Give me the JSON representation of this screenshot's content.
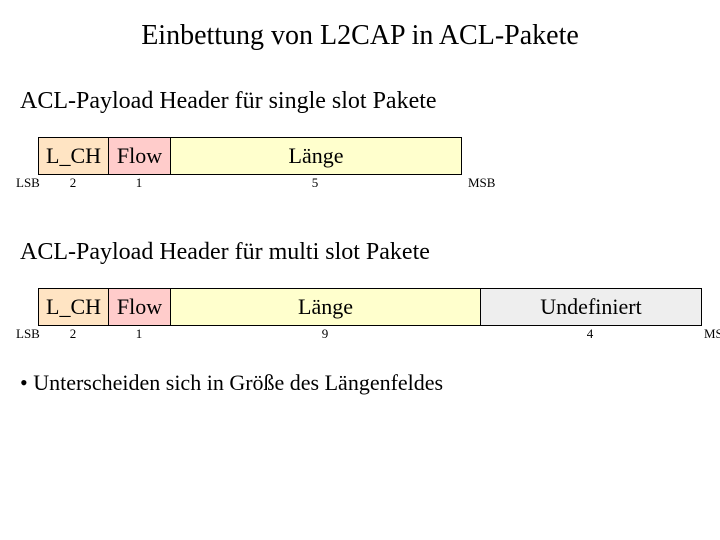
{
  "title": "Einbettung von L2CAP in ACL-Pakete",
  "sections": {
    "single": {
      "subtitle": "ACL-Payload Header für single slot Pakete",
      "lsb": "LSB",
      "msb": "MSB",
      "fields": {
        "lch": {
          "label": "L_CH",
          "bits": "2"
        },
        "flow": {
          "label": "Flow",
          "bits": "1"
        },
        "len": {
          "label": "Länge",
          "bits": "5"
        }
      }
    },
    "multi": {
      "subtitle": "ACL-Payload Header für multi slot Pakete",
      "lsb": "LSB",
      "msb": "MSB",
      "fields": {
        "lch": {
          "label": "L_CH",
          "bits": "2"
        },
        "flow": {
          "label": "Flow",
          "bits": "1"
        },
        "len": {
          "label": "Länge",
          "bits": "9"
        },
        "und": {
          "label": "Undefiniert",
          "bits": "4"
        }
      }
    }
  },
  "bullet": "Unterscheiden sich in Größe des Längenfeldes"
}
